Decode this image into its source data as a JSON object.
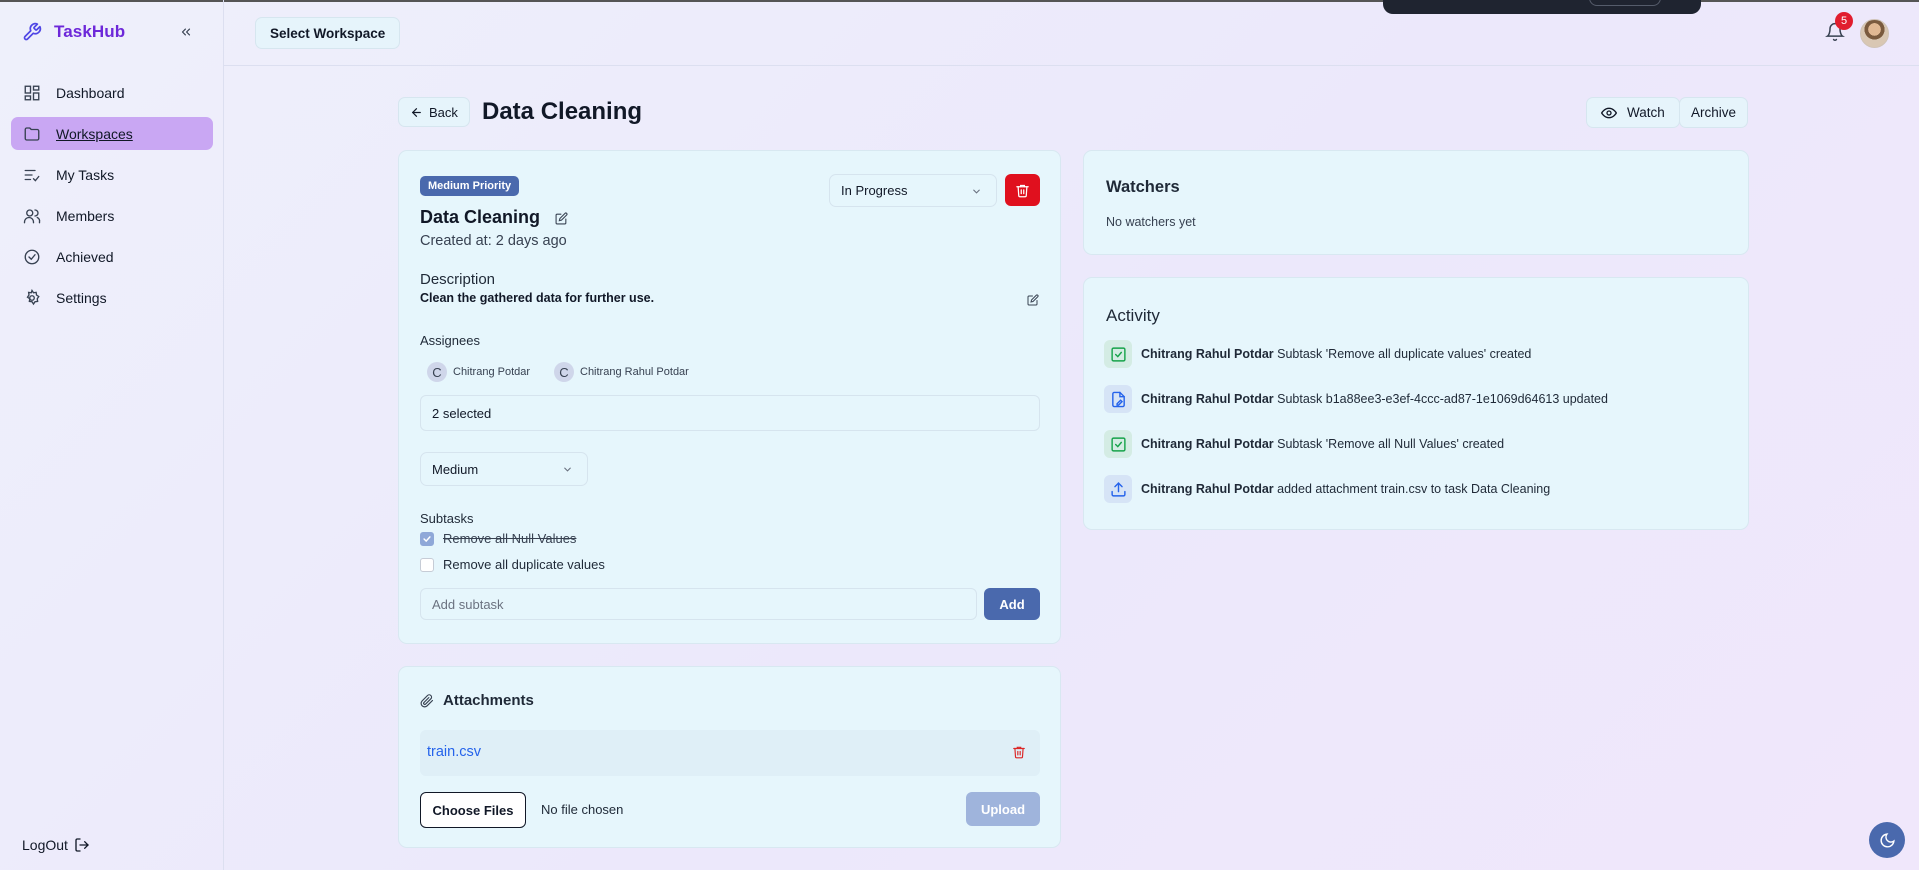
{
  "app": {
    "name": "TaskHub"
  },
  "sidebar": {
    "items": [
      {
        "label": "Dashboard",
        "icon": "dashboard-icon"
      },
      {
        "label": "Workspaces",
        "icon": "folder-icon",
        "active": true
      },
      {
        "label": "My Tasks",
        "icon": "list-check-icon"
      },
      {
        "label": "Members",
        "icon": "users-icon"
      },
      {
        "label": "Achieved",
        "icon": "check-circle-icon"
      },
      {
        "label": "Settings",
        "icon": "gear-icon"
      }
    ],
    "logout_label": "LogOut"
  },
  "header": {
    "workspace_button": "Select Workspace",
    "notification_count": "5"
  },
  "page": {
    "back_label": "Back",
    "title": "Data Cleaning",
    "watch_label": "Watch",
    "archive_label": "Archive"
  },
  "task": {
    "priority_badge": "Medium Priority",
    "title": "Data Cleaning",
    "created": "Created at: 2 days ago",
    "status": "In Progress",
    "description_label": "Description",
    "description": "Clean the gathered data for further use.",
    "assignees_label": "Assignees",
    "assignees": [
      {
        "initial": "C",
        "name": "Chitrang Potdar"
      },
      {
        "initial": "C",
        "name": "Chitrang Rahul Potdar"
      }
    ],
    "selected_text": "2 selected",
    "priority": "Medium",
    "subtasks_label": "Subtasks",
    "subtasks": [
      {
        "title": "Remove all Null Values",
        "done": true
      },
      {
        "title": "Remove all duplicate values",
        "done": false
      }
    ],
    "add_subtask_placeholder": "Add subtask",
    "add_label": "Add"
  },
  "attachments": {
    "title": "Attachments",
    "files": [
      {
        "name": "train.csv"
      }
    ],
    "choose_label": "Choose Files",
    "no_file_text": "No file chosen",
    "upload_label": "Upload"
  },
  "watchers": {
    "title": "Watchers",
    "empty_text": "No watchers yet"
  },
  "activity": {
    "title": "Activity",
    "items": [
      {
        "user": "Chitrang Rahul Potdar",
        "text": "Subtask 'Remove all duplicate values' created",
        "icon": "checkbox-icon"
      },
      {
        "user": "Chitrang Rahul Potdar",
        "text": "Subtask b1a88ee3-e3ef-4ccc-ad87-1e1069d64613 updated",
        "icon": "file-edit-icon"
      },
      {
        "user": "Chitrang Rahul Potdar",
        "text": "Subtask 'Remove all Null Values' created",
        "icon": "checkbox-icon"
      },
      {
        "user": "Chitrang Rahul Potdar",
        "text": "added attachment train.csv to task Data Cleaning",
        "icon": "upload-icon"
      }
    ]
  },
  "colors": {
    "brand": "#6d28d9",
    "active_nav": "#c9a7f3",
    "primary": "#4a69ad",
    "danger": "#e0101e",
    "card": "#e6f6fc"
  }
}
